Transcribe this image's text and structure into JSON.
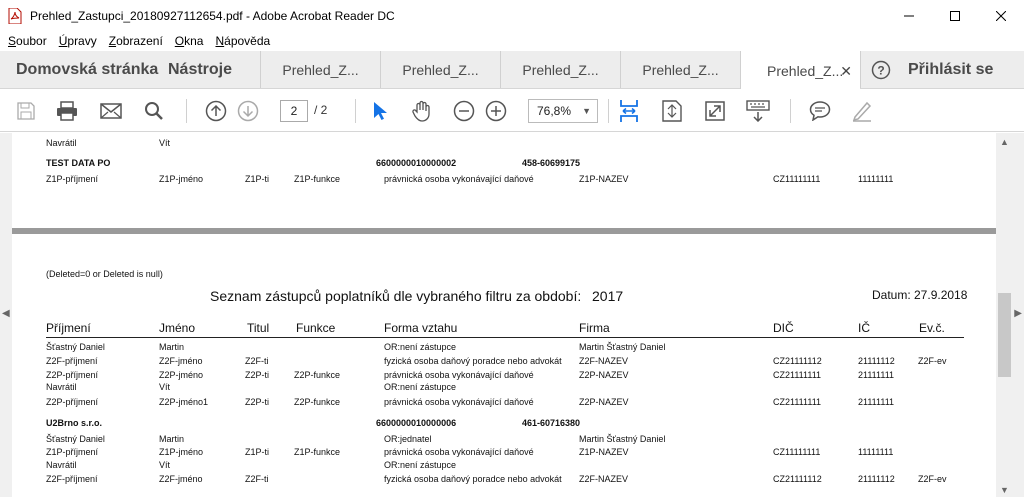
{
  "window": {
    "title": "Prehled_Zastupci_20180927112654.pdf - Adobe Acrobat Reader DC"
  },
  "menu": [
    "Soubor",
    "Úpravy",
    "Zobrazení",
    "Okna",
    "Nápověda"
  ],
  "tabs": {
    "home": "Domovská stránka",
    "tools": "Nástroje",
    "documents": [
      "Prehled_Z...",
      "Prehled_Z...",
      "Prehled_Z...",
      "Prehled_Z...",
      "Prehled_Z..."
    ],
    "signin": "Přihlásit se"
  },
  "toolbar": {
    "page_current": "2",
    "page_total": "/ 2",
    "zoom": "76,8%"
  },
  "page1": {
    "rows": [
      {
        "c1": "Navrátil",
        "c2": "Vít"
      },
      {
        "c1": "TEST DATA PO",
        "num": "6600000010000002",
        "code": "458-60699175"
      },
      {
        "c1": "Z1P-příjmení",
        "c2": "Z1P-jméno",
        "c3": "Z1P-ti",
        "c4": "Z1P-funkce",
        "c5": "právnická osoba vykonávající daňové",
        "c6": "Z1P-NAZEV",
        "c7": "CZ11111111",
        "c8": "11111111"
      }
    ]
  },
  "page2": {
    "filter_note": "(Deleted=0 or Deleted is null)",
    "title": "Seznam zástupců poplatníků dle vybraného filtru za období:",
    "year": "2017",
    "date": "Datum: 27.9.2018",
    "headers": [
      "Příjmení",
      "Jméno",
      "Titul",
      "Funkce",
      "Forma vztahu",
      "Firma",
      "DIČ",
      "IČ",
      "Ev.č."
    ],
    "rows": [
      {
        "c1": "Šťastný Daniel",
        "c2": "Martin",
        "c5": "OR:není zástupce",
        "c6": "Martin Šťastný Daniel"
      },
      {
        "c1": "Z2F-příjmení",
        "c2": "Z2F-jméno",
        "c3": "Z2F-ti",
        "c5": "fyzická osoba daňový poradce nebo advokát",
        "c6": "Z2F-NAZEV",
        "c7": "CZ21111112",
        "c8": "21111112",
        "c9": "Z2F-ev"
      },
      {
        "c1": "Z2P-příjmení",
        "c2": "Z2P-jméno",
        "c3": "Z2P-ti",
        "c4": "Z2P-funkce",
        "c5": "právnická osoba vykonávající daňové",
        "c6": "Z2P-NAZEV",
        "c7": "CZ21111111",
        "c8": "21111111"
      },
      {
        "c1": "Navrátil",
        "c2": "Vít",
        "c5": "OR:není zástupce"
      },
      {
        "c1": "Z2P-příjmení",
        "c2": "Z2P-jméno1",
        "c3": "Z2P-ti",
        "c4": "Z2P-funkce",
        "c5": "právnická osoba vykonávající daňové",
        "c6": "Z2P-NAZEV",
        "c7": "CZ21111111",
        "c8": "21111111"
      },
      {
        "c1": "U2Brno s.r.o.",
        "num": "6600000010000006",
        "code": "461-60716380"
      },
      {
        "c1": "Šťastný Daniel",
        "c2": "Martin",
        "c5": "OR:jednatel",
        "c6": "Martin Šťastný Daniel"
      },
      {
        "c1": "Z1P-příjmení",
        "c2": "Z1P-jméno",
        "c3": "Z1P-ti",
        "c4": "Z1P-funkce",
        "c5": "právnická osoba vykonávající daňové",
        "c6": "Z1P-NAZEV",
        "c7": "CZ11111111",
        "c8": "11111111"
      },
      {
        "c1": "Navrátil",
        "c2": "Vít",
        "c5": "OR:není zástupce"
      },
      {
        "c1": "Z2F-příjmení",
        "c2": "Z2F-jméno",
        "c3": "Z2F-ti",
        "c5": "fyzická osoba daňový poradce nebo advokát",
        "c6": "Z2F-NAZEV",
        "c7": "CZ21111112",
        "c8": "21111112",
        "c9": "Z2F-ev"
      }
    ]
  }
}
